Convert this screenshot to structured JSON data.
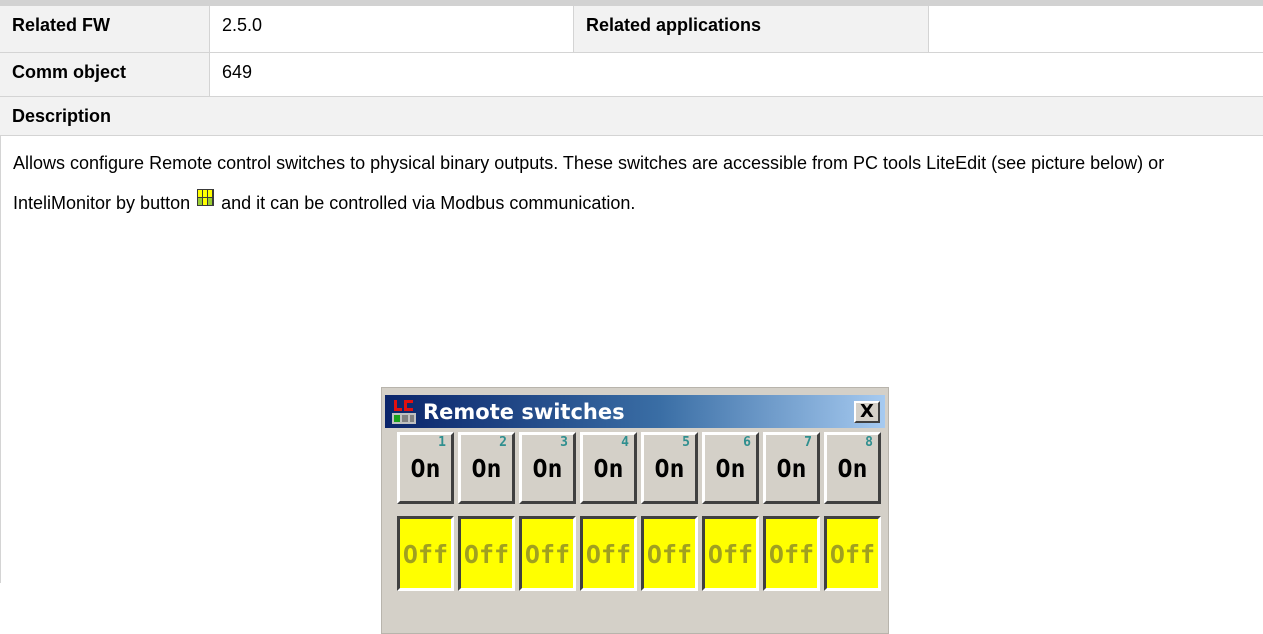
{
  "table": {
    "related_fw_label": "Related FW",
    "related_fw_value": "2.5.0",
    "related_apps_label": "Related applications",
    "related_apps_value": "",
    "comm_object_label": "Comm object",
    "comm_object_value": "649",
    "description_label": "Description",
    "description_part1": "Allows configure Remote control switches to physical binary outputs. These switches are accessible from PC tools LiteEdit (see picture below) or InteliMonitor by button",
    "description_part2": "and it can be controlled via Modbus communication."
  },
  "window": {
    "title": "Remote switches",
    "close_label": "X",
    "switches": [
      {
        "number": "1",
        "on_label": "On",
        "off_label": "Off"
      },
      {
        "number": "2",
        "on_label": "On",
        "off_label": "Off"
      },
      {
        "number": "3",
        "on_label": "On",
        "off_label": "Off"
      },
      {
        "number": "4",
        "on_label": "On",
        "off_label": "Off"
      },
      {
        "number": "5",
        "on_label": "On",
        "off_label": "Off"
      },
      {
        "number": "6",
        "on_label": "On",
        "off_label": "Off"
      },
      {
        "number": "7",
        "on_label": "On",
        "off_label": "Off"
      },
      {
        "number": "8",
        "on_label": "On",
        "off_label": "Off"
      }
    ]
  },
  "icons": {
    "inline_button": "remote-switches-button-icon",
    "app": "liteedit-app-icon",
    "close": "close-icon"
  },
  "colors": {
    "off_active": "#ffff00",
    "on_inactive": "#d4d0c8",
    "title_bar": "#0a246a",
    "label_bg": "#f2f2f2"
  }
}
